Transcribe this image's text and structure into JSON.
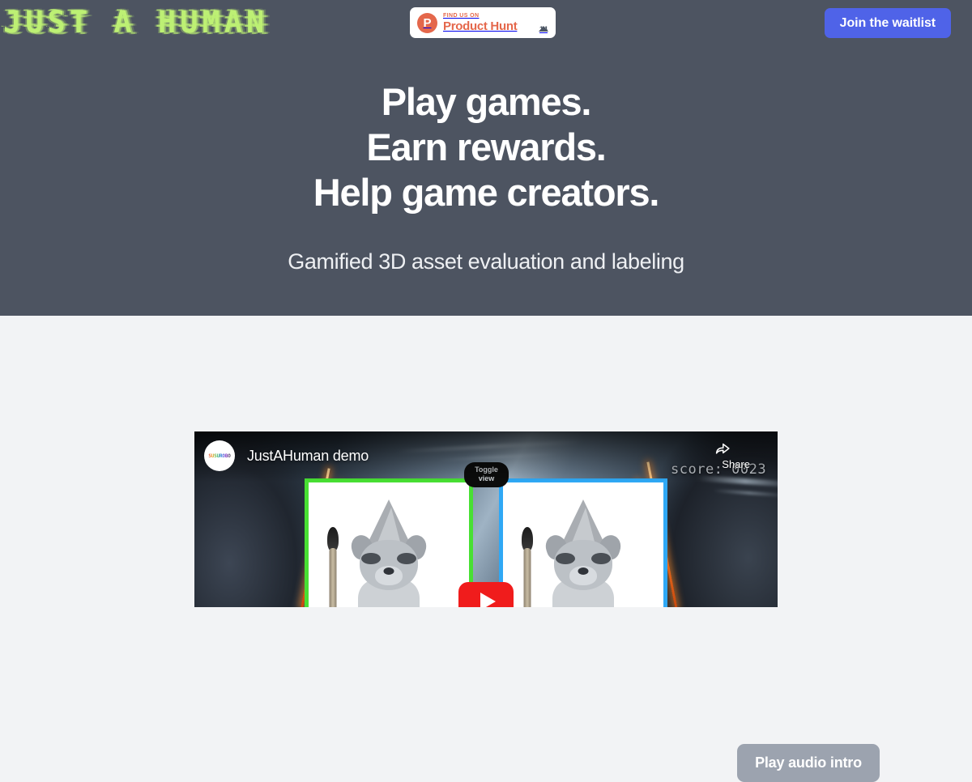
{
  "header": {
    "logo_text": "JUST A HUMAN",
    "logo_color": "#bdf074",
    "product_hunt": {
      "kicker": "FIND US ON",
      "name": "Product Hunt",
      "logo_glyph": "P",
      "upvotes": "14",
      "brand_color": "#e4674b"
    },
    "waitlist_label": "Join the waitlist",
    "waitlist_color": "#4f63e8"
  },
  "hero": {
    "background_color": "#4d5461",
    "headline_lines": [
      "Play games.",
      "Earn rewards.",
      "Help game creators."
    ],
    "subtitle": "Gamified 3D asset evaluation and labeling"
  },
  "lower": {
    "background_color": "#f2f3f5"
  },
  "audio": {
    "button_label": "Play audio intro",
    "button_color": "#9ca3af"
  },
  "video": {
    "channel_avatar_text": "SUSUROBO",
    "title": "JustAHuman demo",
    "share_label": "Share",
    "toggle_label_line1": "Toggle",
    "toggle_label_line2": "view",
    "score_label": "score: 0023",
    "left_card_border_color": "#48e033",
    "right_card_border_color": "#2fa8f5",
    "play_button_color": "#f01c1c"
  }
}
